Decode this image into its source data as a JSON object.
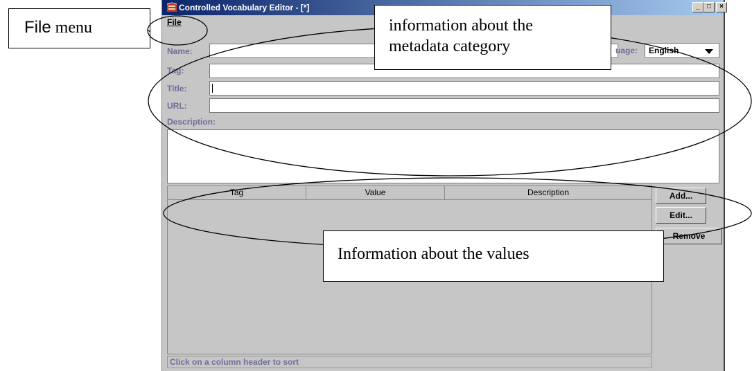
{
  "window": {
    "title": "Controlled Vocabulary Editor - [*]",
    "controls": {
      "minimize": "_",
      "maximize": "□",
      "close": "×"
    }
  },
  "menu": {
    "file_label": "File"
  },
  "form": {
    "name_label": "Name:",
    "name_value": "",
    "language_label": "uage:",
    "language_value": "English",
    "tag_label": "Tag:",
    "tag_value": "",
    "title_label": "Title:",
    "title_value": "",
    "url_label": "URL:",
    "url_value": "",
    "description_label": "Description:",
    "description_value": ""
  },
  "table": {
    "columns": [
      "Tag",
      "Value",
      "Description"
    ],
    "rows": []
  },
  "buttons": {
    "add": "Add...",
    "edit": "Edit...",
    "remove": "Remove"
  },
  "status": {
    "text": "Click on a column header to sort"
  },
  "annotations": {
    "file_menu": {
      "word1": "File",
      "word2": "menu"
    },
    "metadata": {
      "line1": "information about the",
      "line2": "metadata category"
    },
    "values": {
      "text": "Information about the values"
    }
  },
  "icons": {
    "app": "book-icon",
    "dropdown": "triangle-down-icon"
  },
  "colors": {
    "titlebar_start": "#0a246a",
    "titlebar_end": "#a6caf0",
    "window_bg": "#c6c6c6",
    "label": "#6e6e99"
  }
}
